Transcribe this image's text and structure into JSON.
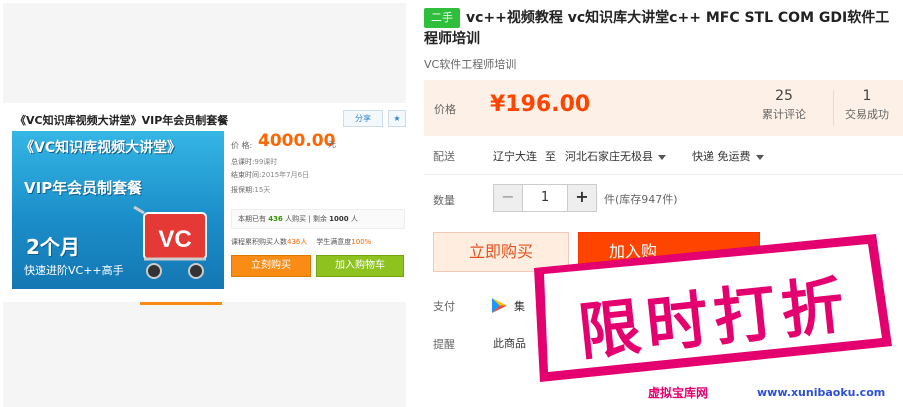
{
  "gallery": {
    "card_title": "《VC知识库视频大讲堂》VIP年会员制套餐",
    "share_label": "分享",
    "star_label": "★",
    "banner": {
      "line1": "《VC知识库视频大讲堂》",
      "line2": "VIP年会员制套餐",
      "line3": "2个月",
      "line4": "快速进阶VC++高手"
    },
    "price_label": "价 格:",
    "price_value": "4000.00",
    "price_unit": "元",
    "meta": [
      {
        "label": "总课时:",
        "value": "99课时"
      },
      {
        "label": "结束时间:",
        "value": "2015年7月6日"
      },
      {
        "label": "报保期:",
        "value": "15天"
      }
    ],
    "stats_prefix": "本期已有",
    "stats_count": "436",
    "stats_mid": "人购买 | 剩余",
    "stats_left": "1000",
    "stats_suffix": "人",
    "row_prefix": "课程累积购买人数",
    "row_count": "436人",
    "row_mid": "学生满意度",
    "row_rate": "100%",
    "buy_label": "立刻购买",
    "cart_label": "加入购物车"
  },
  "product": {
    "tag": "二手",
    "title": "vc++视频教程 vc知识库大讲堂c++ MFC STL COM GDI软件工程师培训",
    "subtitle": "VC软件工程师培训",
    "price_label": "价格",
    "price": "¥196.00",
    "reviews_count": "25",
    "reviews_label": "累计评论",
    "deals_count": "1",
    "deals_label": "交易成功",
    "shipping_label": "配送",
    "ship_from": "辽宁大连",
    "ship_to_word": "至",
    "ship_to": "河北石家庄无极县",
    "ship_method": "快递 免运费",
    "quantity_label": "数量",
    "quantity_value": "1",
    "minus_label": "−",
    "plus_label": "+",
    "stock": "件(库存947件)",
    "buy_now_label": "立即购买",
    "add_cart_label": "加入购",
    "payment_label": "支付",
    "payment_text": "集",
    "hint_label": "提醒",
    "hint_text": "此商品"
  },
  "overlay": {
    "promo_text": "限时打折",
    "watermark": "虚拟宝库网",
    "watermark_url": "www.xunibaoku.com"
  },
  "colors": {
    "accent_orange": "#ff4400",
    "price_red": "#f40",
    "tag_green": "#2fbf3d",
    "promo_pink": "#e4006e"
  }
}
